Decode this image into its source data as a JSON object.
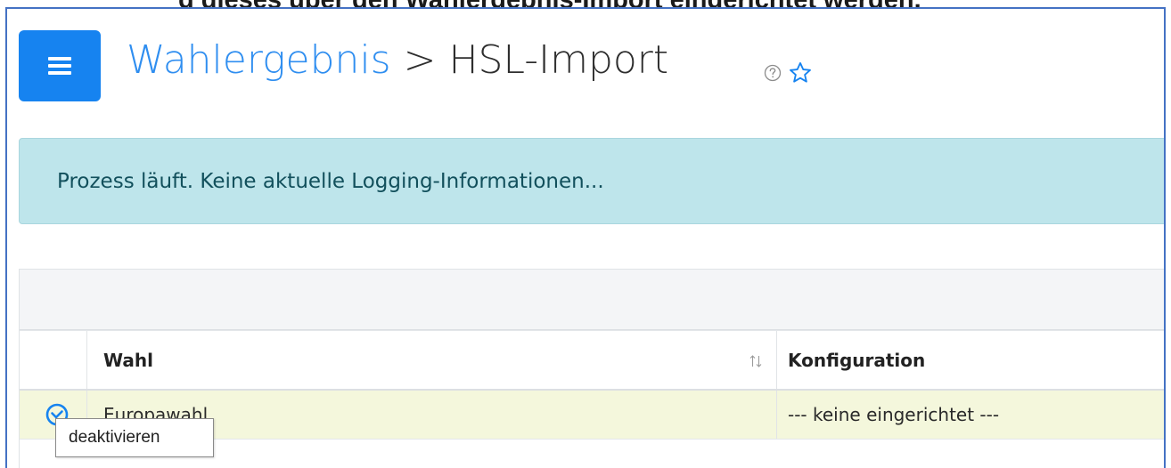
{
  "document": {
    "caption_fragment": "g dieses über den Wahlergebnis-Import eingerichtet werden."
  },
  "header": {
    "breadcrumb_parent": "Wahlergebnis",
    "breadcrumb_separator": ">",
    "title": "HSL-Import",
    "icons": {
      "menu": "hamburger-icon",
      "help": "question-circle-icon",
      "favorite": "star-outline-icon"
    }
  },
  "alert": {
    "message": "Prozess läuft. Keine aktuelle Logging-Informationen..."
  },
  "table": {
    "columns": [
      "Wahl",
      "Konfiguration"
    ],
    "rows": [
      {
        "action_icon": "check-circle-icon",
        "wahl": "Europawahl",
        "konfiguration": "--- keine eingerichtet ---"
      }
    ]
  },
  "tooltip": {
    "text": "deaktivieren"
  },
  "colors": {
    "primary": "#1683f0",
    "link": "#2f8ef0",
    "alert_bg": "#bee5eb",
    "alert_text": "#12505c",
    "row_highlight": "#f4f7dc",
    "frame_border": "#4472c4"
  }
}
